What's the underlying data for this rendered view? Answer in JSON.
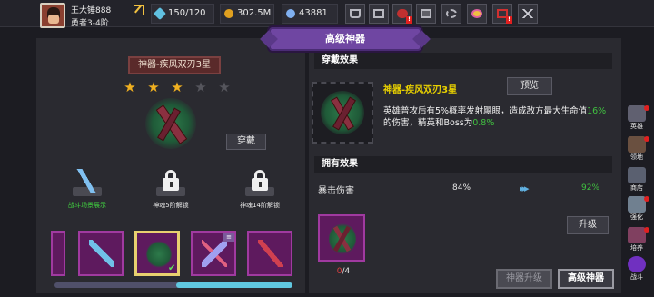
{
  "player": {
    "name": "王大锤888",
    "rank": "勇者3-4阶"
  },
  "resources": {
    "energy": "150/120",
    "gold": "302.5M",
    "gems": "43881"
  },
  "colors": {
    "panel_bg": "#2a2a30",
    "ribbon": "#6f46a2",
    "rarity_purple": "#a03aa0",
    "highlight_green": "#40c040",
    "title_yellow": "#e8d000",
    "star_gold": "#f0b020",
    "star_empty": "#55555c"
  },
  "toolbar_icons": [
    "shop-cart-icon",
    "mail-icon",
    "gamepad-icon",
    "gift-icon",
    "settings-gear-icon",
    "color-wheel-icon",
    "alert-icon",
    "close-icon"
  ],
  "header": {
    "title": "高级神器"
  },
  "artifact": {
    "title": "神器-疾风双刃3星",
    "stars_filled": 3,
    "stars_total": 5,
    "equip_label": "穿戴"
  },
  "slots": [
    {
      "label": "战斗场景展示",
      "state": "unlocked"
    },
    {
      "label": "神魂5阶解锁",
      "state": "locked"
    },
    {
      "label": "神魂14阶解锁",
      "state": "locked"
    }
  ],
  "wear_effect": {
    "section_title": "穿戴效果",
    "name": "神器-疾风双刃3星",
    "preview_label": "预览",
    "desc_part1": "英雄普攻后有5%概率发射飓眼，造成敌方最大生命值",
    "desc_val1": "16%",
    "desc_part2": "的伤害，精英和Boss为",
    "desc_val2": "0.8%"
  },
  "owned_effect": {
    "section_title": "拥有效果",
    "stat_name": "暴击伤害",
    "stat_current": "84%",
    "stat_next": "92%",
    "upgrade_label": "升级",
    "shards_have": "0",
    "shards_need": "/4"
  },
  "bottom_buttons": {
    "artifact_upgrade": "神器升级",
    "advanced_artifact": "高级神器"
  },
  "side_nav": [
    {
      "label": "英雄",
      "icon": "hero-icon"
    },
    {
      "label": "领地",
      "icon": "territory-icon"
    },
    {
      "label": "商店",
      "icon": "shop-icon"
    },
    {
      "label": "强化",
      "icon": "enhance-icon"
    },
    {
      "label": "培养",
      "icon": "cultivate-icon"
    },
    {
      "label": "战斗",
      "icon": "battle-icon"
    }
  ]
}
